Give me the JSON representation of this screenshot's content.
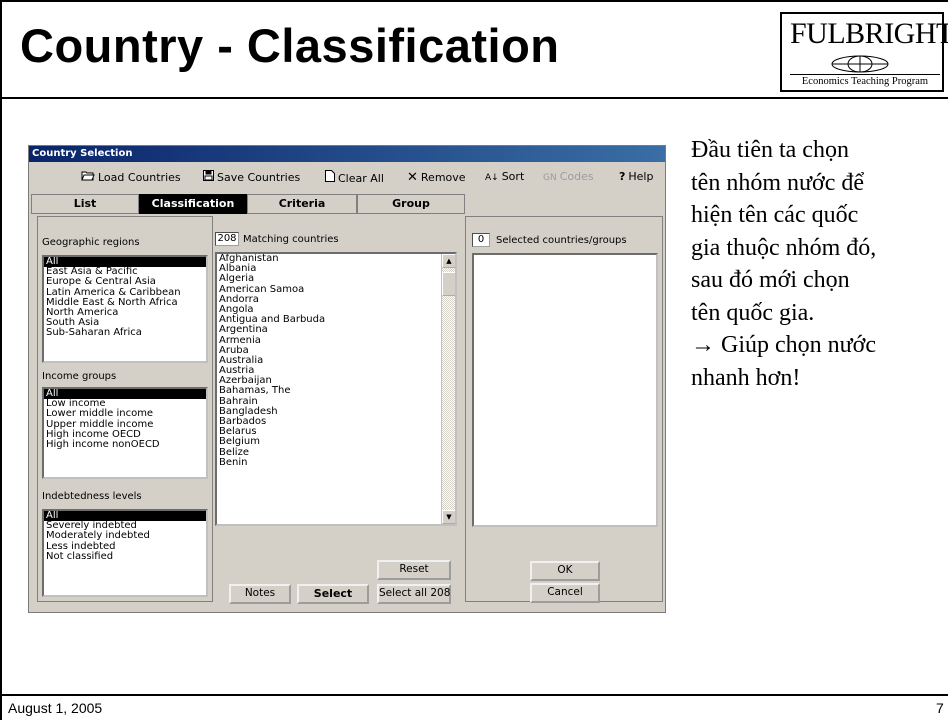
{
  "slide": {
    "title": "Country - Classification",
    "footer_date": "August 1, 2005",
    "page_number": "7",
    "logo": {
      "main": "FULBRIGHT",
      "sub": "Economics Teaching Program"
    },
    "body_lines": [
      "Đầu tiên ta chọn",
      "tên nhóm nước để",
      "hiện tên các quốc",
      "gia thuộc nhóm đó,",
      "sau đó mới chọn",
      "tên quốc gia.",
      "→ Giúp chọn nước",
      "nhanh hơn!"
    ]
  },
  "dialog": {
    "title": "Country Selection",
    "toolbar": {
      "load": "Load Countries",
      "save": "Save Countries",
      "clear": "Clear All",
      "remove": "Remove",
      "sort": "Sort",
      "codes": "Codes",
      "help": "Help"
    },
    "tabs": [
      "List",
      "Classification",
      "Criteria",
      "Group"
    ],
    "active_tab": "Classification",
    "geo": {
      "label": "Geographic regions",
      "items": [
        "All",
        "East Asia & Pacific",
        "Europe & Central Asia",
        "Latin America & Caribbean",
        "Middle East & North Africa",
        "North America",
        "South Asia",
        "Sub-Saharan Africa"
      ]
    },
    "income": {
      "label": "Income groups",
      "items": [
        "All",
        "Low income",
        "Lower middle income",
        "Upper middle income",
        "High income OECD",
        "High income nonOECD"
      ]
    },
    "debt": {
      "label": "Indebtedness levels",
      "items": [
        "All",
        "Severely indebted",
        "Moderately indebted",
        "Less indebted",
        "Not classified"
      ]
    },
    "matching": {
      "count": "208",
      "label": "Matching countries",
      "countries": [
        "Afghanistan",
        "Albania",
        "Algeria",
        "American Samoa",
        "Andorra",
        "Angola",
        "Antigua and Barbuda",
        "Argentina",
        "Armenia",
        "Aruba",
        "Australia",
        "Austria",
        "Azerbaijan",
        "Bahamas, The",
        "Bahrain",
        "Bangladesh",
        "Barbados",
        "Belarus",
        "Belgium",
        "Belize",
        "Benin"
      ]
    },
    "selected": {
      "count": "0",
      "label": "Selected countries/groups"
    },
    "buttons": {
      "reset": "Reset",
      "notes": "Notes",
      "select": "Select",
      "select_all": "Select all 208",
      "ok": "OK",
      "cancel": "Cancel"
    }
  }
}
